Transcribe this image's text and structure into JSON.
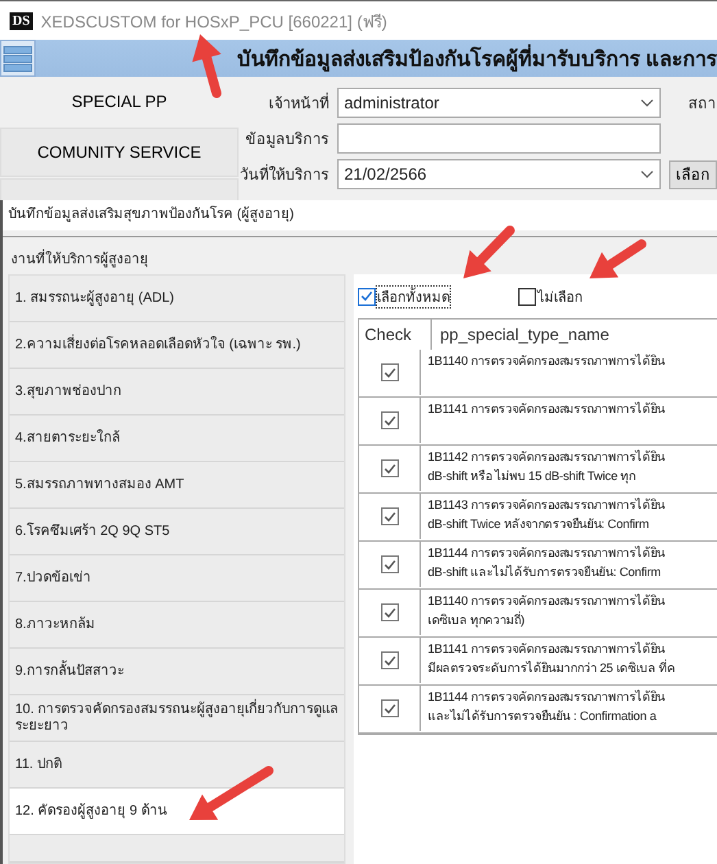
{
  "window": {
    "logo": "DS",
    "title": "XEDSCUSTOM for HOSxP_PCU [660221] (ฟรี)"
  },
  "header": {
    "title": "บันทึกข้อมูลส่งเสริมป้องกันโรคผู้ที่มารับบริการ และการ"
  },
  "nav": [
    {
      "label": "SPECIAL PP",
      "selected": true
    },
    {
      "label": "COMUNITY SERVICE",
      "selected": false
    }
  ],
  "form": {
    "fields": [
      {
        "label": "เจ้าหน้าที่",
        "kind": "select",
        "value": "administrator"
      },
      {
        "label": "ข้อมูลบริการ",
        "kind": "text"
      },
      {
        "label": "วันที่ให้บริการ",
        "kind": "select",
        "value": "21/02/2566"
      }
    ],
    "side_label": "สถา",
    "button": "เลือก"
  },
  "dialog": {
    "title": "บันทึกข้อมูลส่งเสริมสุขภาพป้องกันโรค (ผู้สูงอายุ)",
    "group": "งานที่ให้บริการผู้สูงอายุ",
    "items": [
      {
        "label": "1. สมรรถนะผู้สูงอายุ (ADL)",
        "selected": false
      },
      {
        "label": "2.ความเสี่ยงต่อโรคหลอดเลือดหัวใจ (เฉพาะ รพ.)",
        "selected": false
      },
      {
        "label": "3.สุขภาพช่องปาก",
        "selected": false
      },
      {
        "label": "4.สายตาระยะใกล้",
        "selected": false
      },
      {
        "label": "5.สมรรถภาพทางสมอง  AMT",
        "selected": false
      },
      {
        "label": "6.โรคซึมเศร้า 2Q 9Q ST5",
        "selected": false
      },
      {
        "label": "7.ปวดข้อเข่า",
        "selected": false
      },
      {
        "label": "8.ภาวะหกล้ม",
        "selected": false
      },
      {
        "label": "9.การกลั้นปัสสาวะ",
        "selected": false
      },
      {
        "label": "10. การตรวจคัดกรองสมรรถนะผู้สูงอายุเกี่ยวกับการดูแลระยะยาว",
        "selected": false
      },
      {
        "label": "11. ปกติ",
        "selected": false
      },
      {
        "label": "12. คัดรองผู้สูงอายุ 9 ด้าน",
        "selected": true
      }
    ],
    "select_all": {
      "label": "เลือกทั้งหมด",
      "checked": true
    },
    "select_none": {
      "label": "ไม่เลือก",
      "checked": false
    },
    "table": {
      "columns": [
        "Check",
        "pp_special_type_name"
      ],
      "rows": [
        {
          "checked": true,
          "lines": [
            "1B1140 การตรวจคัดกรองสมรรถภาพการได้ยิน"
          ]
        },
        {
          "checked": true,
          "lines": [
            "1B1141 การตรวจคัดกรองสมรรถภาพการได้ยิน"
          ]
        },
        {
          "checked": true,
          "lines": [
            "1B1142 การตรวจคัดกรองสมรรถภาพการได้ยิน",
            "dB-shift หรือ ไม่พบ 15 dB-shift Twice ทุก"
          ]
        },
        {
          "checked": true,
          "lines": [
            "1B1143 การตรวจคัดกรองสมรรถภาพการได้ยิน",
            "dB-shift Twice หลังจากตรวจยืนยัน: Confirm"
          ]
        },
        {
          "checked": true,
          "lines": [
            "1B1144 การตรวจคัดกรองสมรรถภาพการได้ยิน",
            "dB-shift และไม่ได้รับการตรวจยืนยัน: Confirm"
          ]
        },
        {
          "checked": true,
          "lines": [
            "1B1140 การตรวจคัดกรองสมรรถภาพการได้ยิน",
            "เดซิเบล ทุกความถี่)"
          ]
        },
        {
          "checked": true,
          "lines": [
            "1B1141 การตรวจคัดกรองสมรรถภาพการได้ยิน",
            "มีผลตรวจระดับการได้ยินมากกว่า 25 เดซิเบล ที่ค"
          ]
        },
        {
          "checked": true,
          "lines": [
            "1B1144 การตรวจคัดกรองสมรรถภาพการได้ยิน",
            "และไม่ได้รับการตรวจยืนยัน : Confirmation a"
          ]
        }
      ]
    }
  }
}
